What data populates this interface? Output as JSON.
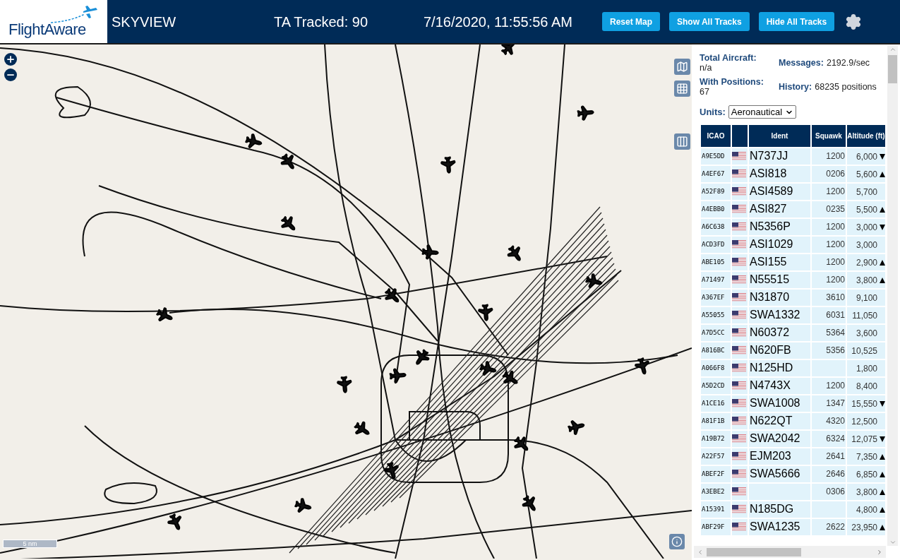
{
  "header": {
    "logo": "FlightAware",
    "title": "SKYVIEW",
    "tracked": "TA Tracked: 90",
    "datetime": "7/16/2020, 11:55:56 AM",
    "buttons": [
      "Reset Map",
      "Show All Tracks",
      "Hide All Tracks"
    ]
  },
  "map": {
    "scale": "5 nm"
  },
  "stats": [
    {
      "label": "Total Aircraft:",
      "value": "n/a"
    },
    {
      "label": "Messages:",
      "value": "2192.9/sec"
    },
    {
      "label": "With Positions:",
      "value": "67"
    },
    {
      "label": "History:",
      "value": "68235 positions"
    }
  ],
  "units": {
    "label": "Units:",
    "value": "Aeronautical"
  },
  "table": {
    "columns": [
      "ICAO",
      "Ident",
      "Squawk",
      "Altitude (ft)"
    ],
    "rows": [
      {
        "icao": "A9E5DD",
        "ident": "N737JJ",
        "squawk": "1200",
        "altitude": "6,000",
        "climbing": false,
        "descending": true
      },
      {
        "icao": "A4EF67",
        "ident": "ASI818",
        "squawk": "0206",
        "altitude": "5,600",
        "climbing": true,
        "descending": false
      },
      {
        "icao": "A52F89",
        "ident": "ASI4589",
        "squawk": "1200",
        "altitude": "5,700",
        "climbing": false,
        "descending": false
      },
      {
        "icao": "A4EBB0",
        "ident": "ASI827",
        "squawk": "0235",
        "altitude": "5,500",
        "climbing": true,
        "descending": false
      },
      {
        "icao": "A6C638",
        "ident": "N5356P",
        "squawk": "1200",
        "altitude": "3,000",
        "climbing": false,
        "descending": true
      },
      {
        "icao": "ACD3FD",
        "ident": "ASI1029",
        "squawk": "1200",
        "altitude": "3,000",
        "climbing": false,
        "descending": false
      },
      {
        "icao": "ABE105",
        "ident": "ASI155",
        "squawk": "1200",
        "altitude": "2,900",
        "climbing": true,
        "descending": false
      },
      {
        "icao": "A71497",
        "ident": "N55515",
        "squawk": "1200",
        "altitude": "3,800",
        "climbing": true,
        "descending": false
      },
      {
        "icao": "A367EF",
        "ident": "N31870",
        "squawk": "3610",
        "altitude": "9,100",
        "climbing": false,
        "descending": false
      },
      {
        "icao": "A55055",
        "ident": "SWA1332",
        "squawk": "6031",
        "altitude": "11,050",
        "climbing": false,
        "descending": false
      },
      {
        "icao": "A7D5CC",
        "ident": "N60372",
        "squawk": "5364",
        "altitude": "3,600",
        "climbing": false,
        "descending": false
      },
      {
        "icao": "A816BC",
        "ident": "N620FB",
        "squawk": "5356",
        "altitude": "10,525",
        "climbing": false,
        "descending": false
      },
      {
        "icao": "A066F8",
        "ident": "N125HD",
        "altitude": "1,800",
        "climbing": false,
        "descending": false
      },
      {
        "icao": "A5D2CD",
        "ident": "N4743X",
        "squawk": "1200",
        "altitude": "8,400",
        "climbing": false,
        "descending": false
      },
      {
        "icao": "A1CE16",
        "ident": "SWA1008",
        "squawk": "1347",
        "altitude": "15,550",
        "climbing": false,
        "descending": true
      },
      {
        "icao": "A81F1B",
        "ident": "N622QT",
        "squawk": "4320",
        "altitude": "12,500",
        "climbing": false,
        "descending": false
      },
      {
        "icao": "A19B72",
        "ident": "SWA2042",
        "squawk": "6324",
        "altitude": "12,075",
        "climbing": false,
        "descending": true
      },
      {
        "icao": "A22F57",
        "ident": "EJM203",
        "squawk": "2641",
        "altitude": "7,350",
        "climbing": true,
        "descending": false
      },
      {
        "icao": "ABEF2F",
        "ident": "SWA5666",
        "squawk": "2646",
        "altitude": "6,850",
        "climbing": true,
        "descending": false
      },
      {
        "icao": "A3EBE2",
        "squawk": "0306",
        "altitude": "3,800",
        "climbing": true,
        "descending": false
      },
      {
        "icao": "A15391",
        "ident": "N185DG",
        "altitude": "4,800",
        "climbing": true,
        "descending": false
      },
      {
        "icao": "ABF29F",
        "ident": "SWA1235",
        "squawk": "2622",
        "altitude": "23,950",
        "climbing": true,
        "descending": false
      }
    ]
  }
}
